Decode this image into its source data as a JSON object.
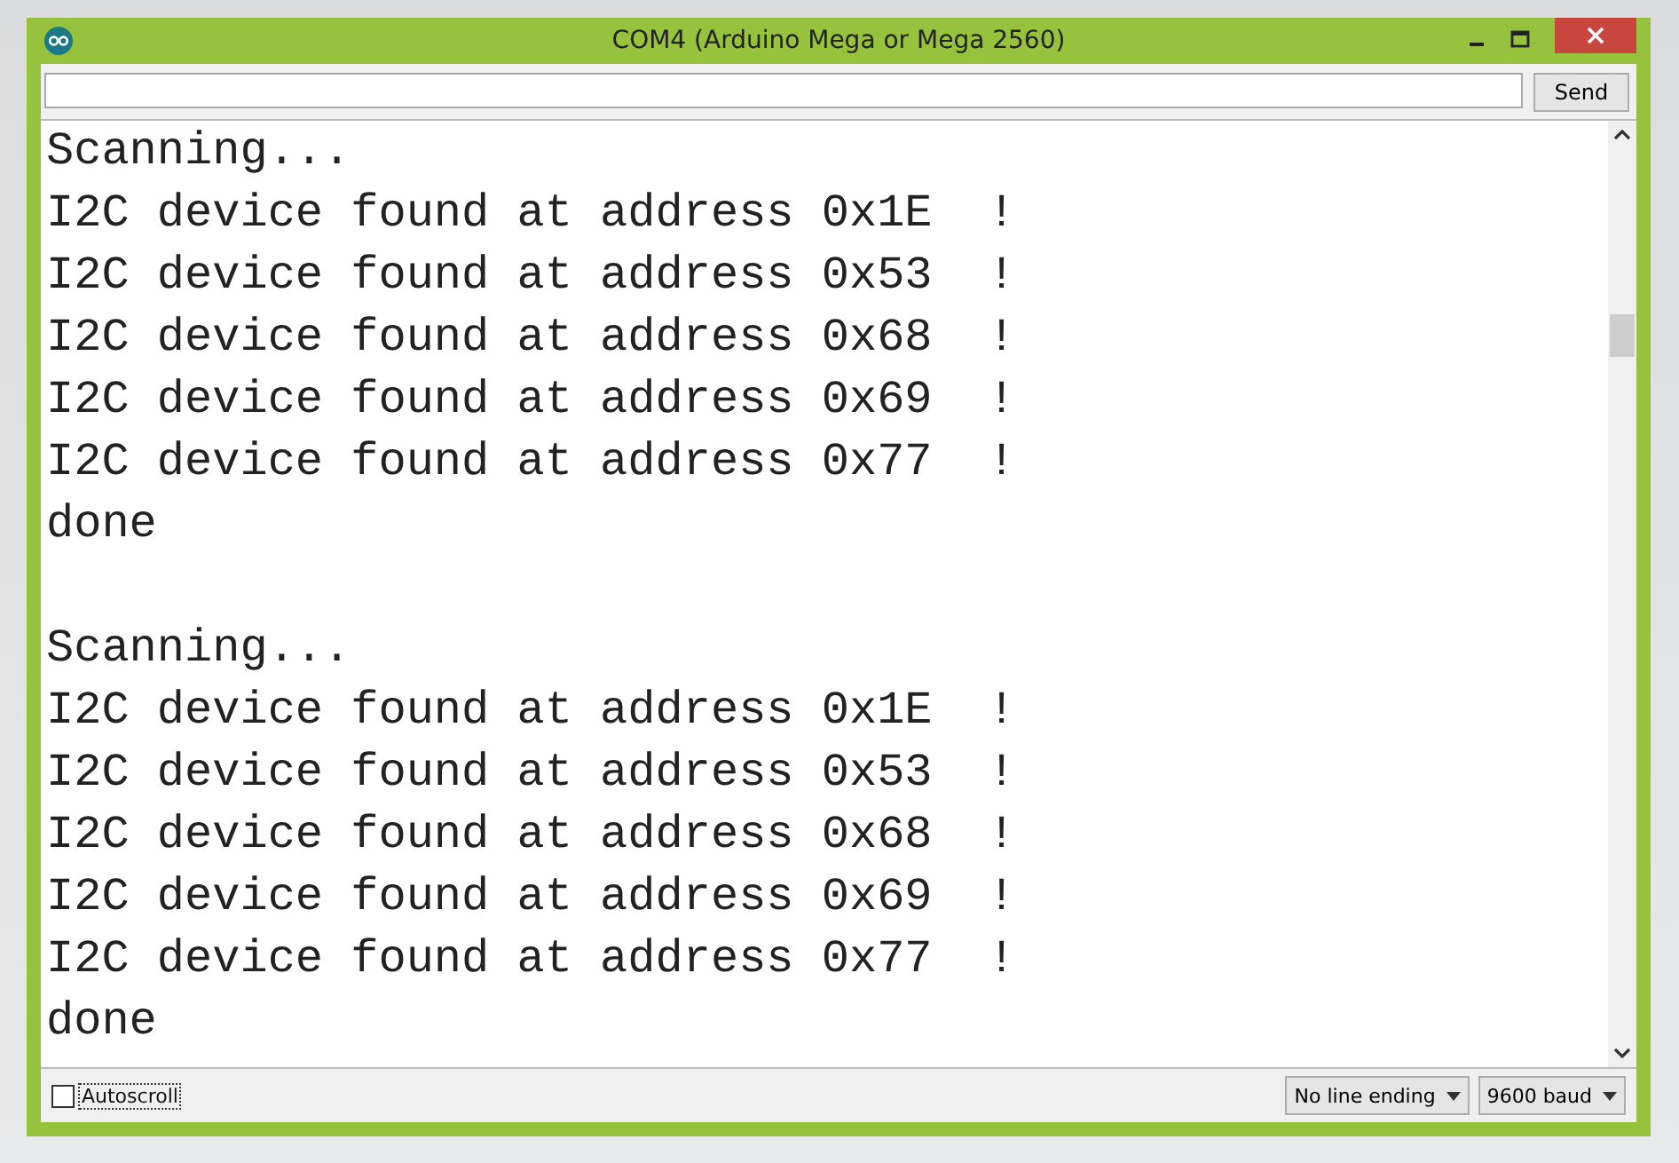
{
  "window": {
    "title": "COM4 (Arduino Mega or Mega 2560)"
  },
  "send_button": "Send",
  "output": [
    {
      "header": "Scanning...",
      "lines": [
        "I2C device found at address 0x1E  !",
        "I2C device found at address 0x53  !",
        "I2C device found at address 0x68  !",
        "I2C device found at address 0x69  !",
        "I2C device found at address 0x77  !"
      ],
      "footer": "done"
    },
    {
      "header": "Scanning...",
      "lines": [
        "I2C device found at address 0x1E  !",
        "I2C device found at address 0x53  !",
        "I2C device found at address 0x68  !",
        "I2C device found at address 0x69  !",
        "I2C device found at address 0x77  !"
      ],
      "footer": "done"
    }
  ],
  "autoscroll": {
    "label": "Autoscroll",
    "checked": false
  },
  "line_ending": "No line ending",
  "baud": "9600 baud"
}
